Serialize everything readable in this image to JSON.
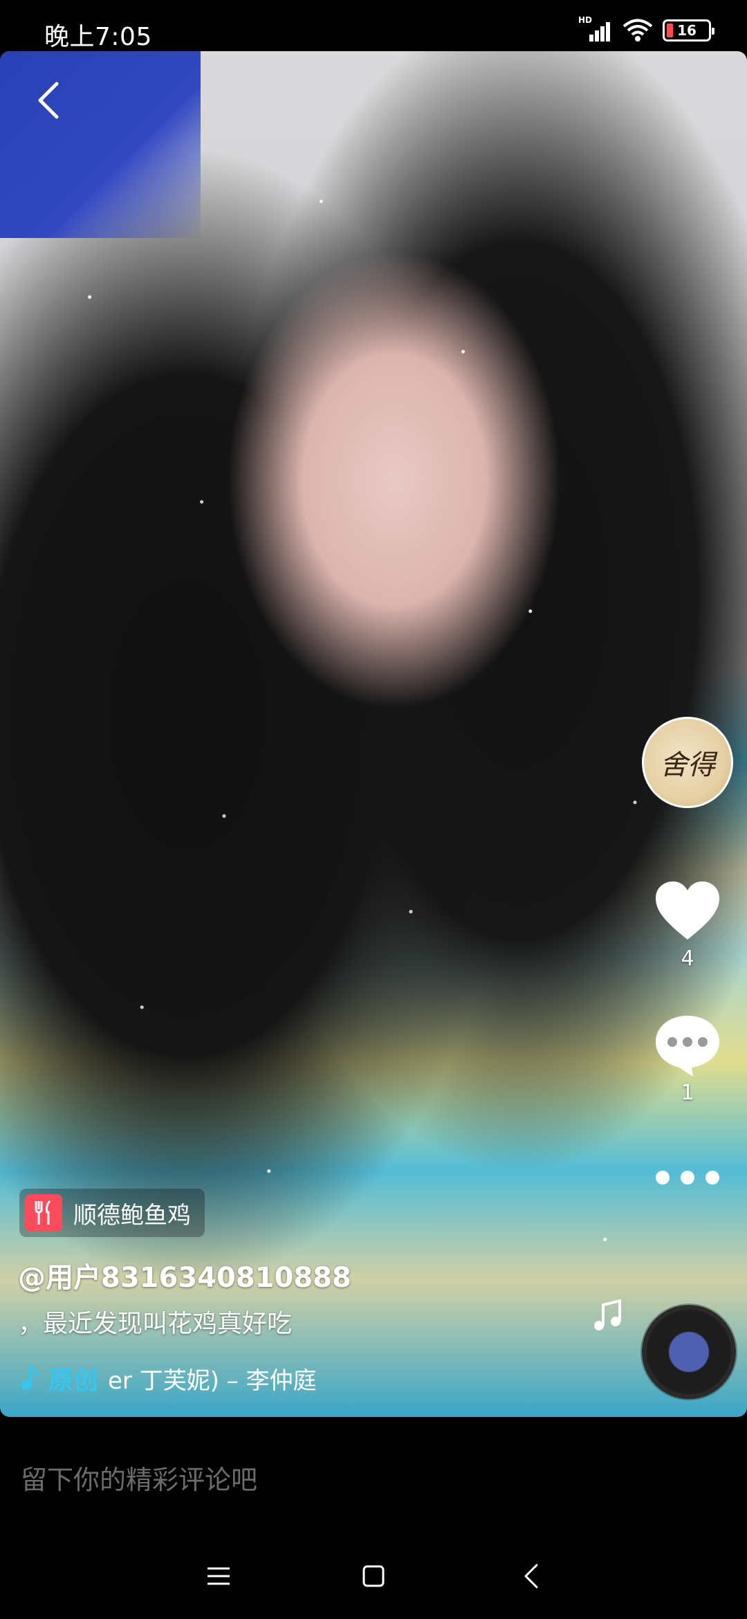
{
  "status_bar": {
    "time": "晚上7:05",
    "battery_level": "16",
    "network_label": "HD"
  },
  "video": {
    "creator_avatar_text": "舍得",
    "like_count": "4",
    "comment_count": "1",
    "poi_label": "顺德鲍鱼鸡",
    "username": "@用户8316340810888",
    "caption": "，最近发现叫花鸡真好吃",
    "music_original_label": "原创",
    "music_title": "er 丁芙妮) – 李仲庭"
  },
  "comment_bar": {
    "placeholder": "留下你的精彩评论吧"
  },
  "colors": {
    "accent_music": "#34c7f0",
    "poi_icon_bg": "#ff4a5c"
  },
  "icons": {
    "back": "chevron-left-icon",
    "like": "heart-icon",
    "comment": "chat-bubble-icon",
    "more": "more-dots-icon",
    "music": "music-note-icon",
    "poi": "fork-knife-icon"
  }
}
